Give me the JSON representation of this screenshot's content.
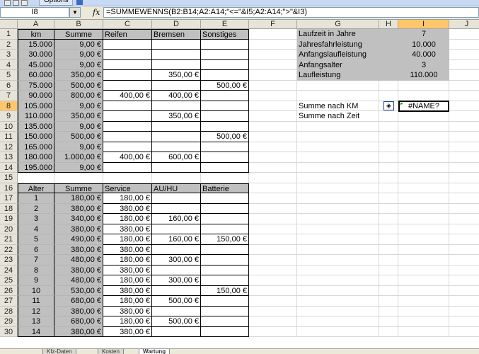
{
  "toolbar": {
    "options_label": "Options"
  },
  "formula_bar": {
    "name_box": "I8",
    "fx_label": "fx",
    "formula": "=SUMMEWENNS(B2:B14;A2:A14;\"<=\"&I5;A2:A14;\">\"&I3)"
  },
  "columns": [
    "A",
    "B",
    "C",
    "D",
    "E",
    "F",
    "G",
    "H",
    "I",
    "J"
  ],
  "selected": {
    "column": "I",
    "row": "8"
  },
  "rows": [
    "1",
    "2",
    "3",
    "4",
    "5",
    "6",
    "7",
    "8",
    "9",
    "10",
    "11",
    "12",
    "13",
    "14",
    "15",
    "16",
    "17",
    "18",
    "19",
    "20",
    "21",
    "22",
    "23",
    "24",
    "25",
    "26",
    "27",
    "28",
    "29",
    "30"
  ],
  "table1": {
    "headers": [
      "km",
      "Summe",
      "Reifen",
      "Bremsen",
      "Sonstiges"
    ],
    "rows": [
      [
        "15.000",
        "9,00 €",
        "",
        "",
        ""
      ],
      [
        "30.000",
        "9,00 €",
        "",
        "",
        ""
      ],
      [
        "45.000",
        "9,00 €",
        "",
        "",
        ""
      ],
      [
        "60.000",
        "350,00 €",
        "",
        "350,00 €",
        ""
      ],
      [
        "75.000",
        "500,00 €",
        "",
        "",
        "500,00 €"
      ],
      [
        "90.000",
        "800,00 €",
        "400,00 €",
        "400,00 €",
        ""
      ],
      [
        "105.000",
        "9,00 €",
        "",
        "",
        ""
      ],
      [
        "110.000",
        "350,00 €",
        "",
        "350,00 €",
        ""
      ],
      [
        "135.000",
        "9,00 €",
        "",
        "",
        ""
      ],
      [
        "150.000",
        "500,00 €",
        "",
        "",
        "500,00 €"
      ],
      [
        "165.000",
        "9,00 €",
        "",
        "",
        ""
      ],
      [
        "180.000",
        "1.000,00 €",
        "400,00 €",
        "600,00 €",
        ""
      ],
      [
        "195.000",
        "9,00 €",
        "",
        "",
        ""
      ]
    ]
  },
  "table2": {
    "headers": [
      "Alter",
      "Summe",
      "Service",
      "AU/HU",
      "Batterie"
    ],
    "rows": [
      [
        "1",
        "180,00 €",
        "180,00 €",
        "",
        ""
      ],
      [
        "2",
        "380,00 €",
        "380,00 €",
        "",
        ""
      ],
      [
        "3",
        "340,00 €",
        "180,00 €",
        "160,00 €",
        ""
      ],
      [
        "4",
        "380,00 €",
        "380,00 €",
        "",
        ""
      ],
      [
        "5",
        "490,00 €",
        "180,00 €",
        "160,00 €",
        "150,00 €"
      ],
      [
        "6",
        "380,00 €",
        "380,00 €",
        "",
        ""
      ],
      [
        "7",
        "480,00 €",
        "180,00 €",
        "300,00 €",
        ""
      ],
      [
        "8",
        "380,00 €",
        "380,00 €",
        "",
        ""
      ],
      [
        "9",
        "480,00 €",
        "180,00 €",
        "300,00 €",
        ""
      ],
      [
        "10",
        "530,00 €",
        "380,00 €",
        "",
        "150,00 €"
      ],
      [
        "11",
        "680,00 €",
        "180,00 €",
        "500,00 €",
        ""
      ],
      [
        "12",
        "380,00 €",
        "380,00 €",
        "",
        ""
      ],
      [
        "13",
        "680,00 €",
        "180,00 €",
        "500,00 €",
        ""
      ],
      [
        "14",
        "380,00 €",
        "380,00 €",
        "",
        ""
      ]
    ]
  },
  "info": {
    "rows": [
      [
        "Laufzeit in Jahre",
        "7"
      ],
      [
        "Jahresfahrleistung",
        "10.000"
      ],
      [
        "Anfangslaufleistung",
        "40.000"
      ],
      [
        "Anfangsalter",
        "3"
      ],
      [
        "Laufleistung",
        "110.000"
      ]
    ],
    "summe_km_label": "Summe nach KM",
    "summe_zeit_label": "Summe nach Zeit",
    "result": "#NAME?"
  },
  "tabs": [
    "Kfz-Daten",
    "Kosten",
    "Wartung"
  ],
  "colors": {
    "gray_fill": "#c0c0c0",
    "selection_header": "#ffc66b",
    "header_bg": "#e6e4d8"
  }
}
